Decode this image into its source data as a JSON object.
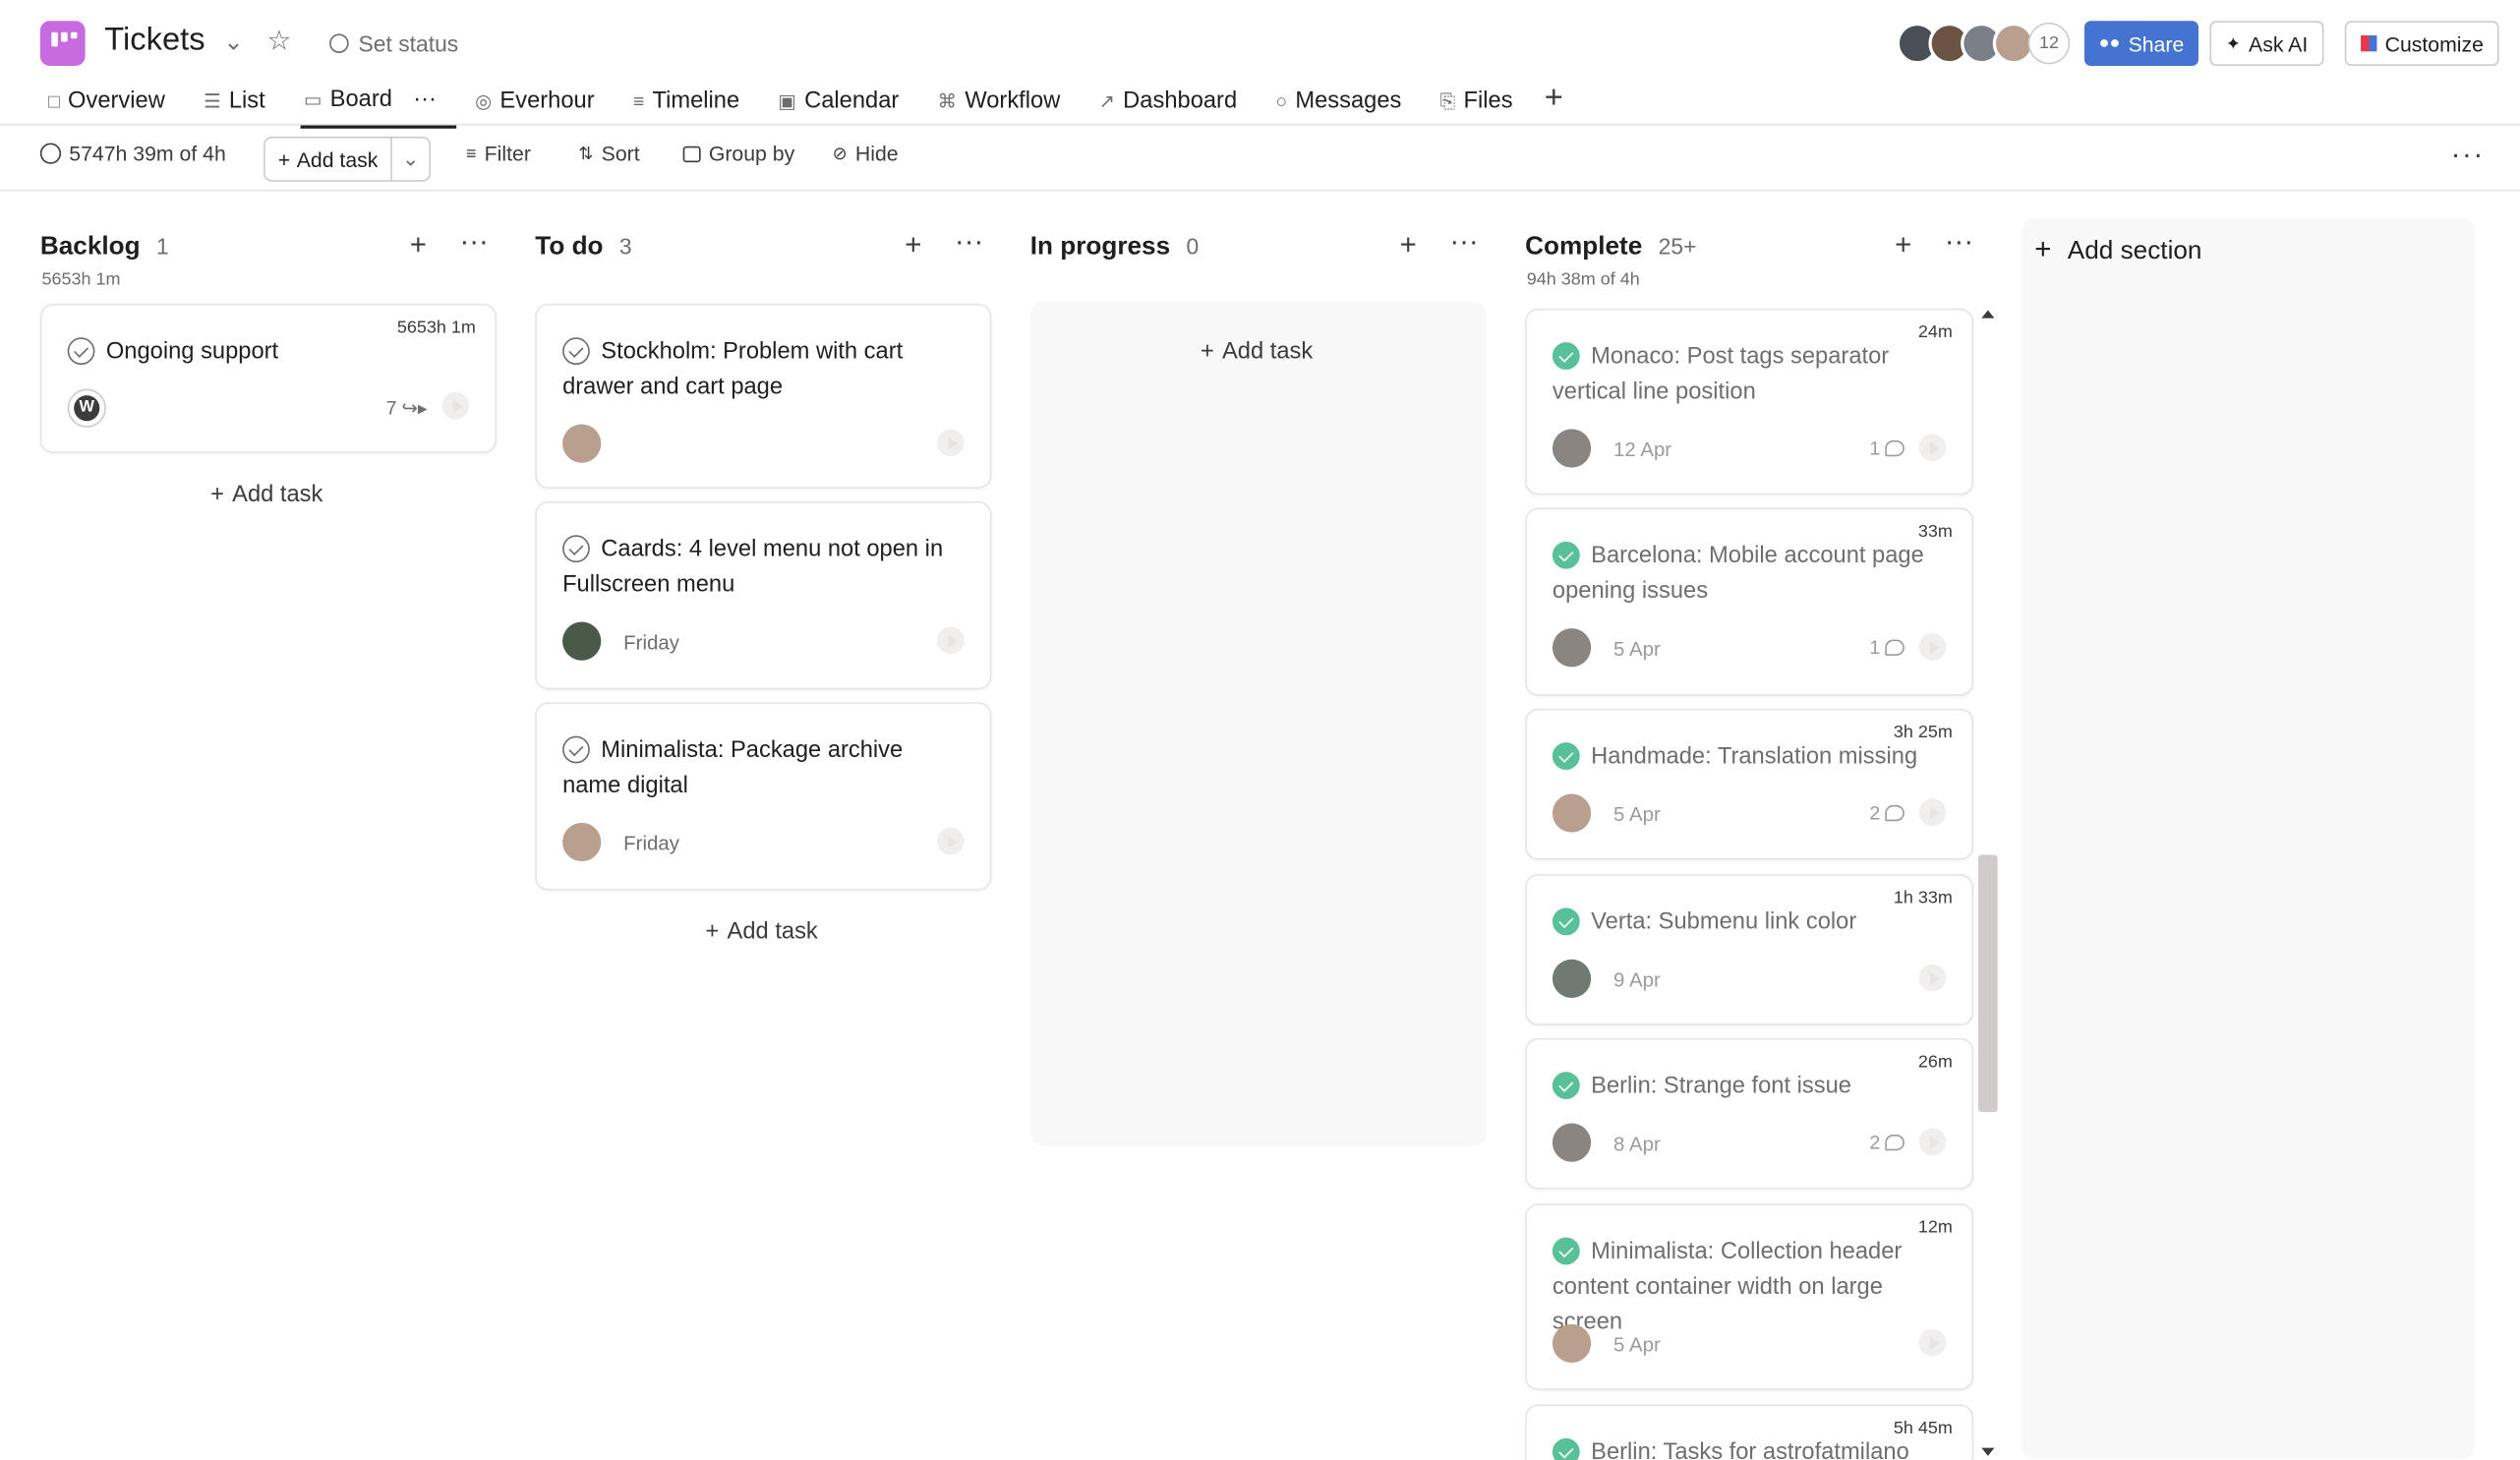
{
  "header": {
    "title": "Tickets",
    "set_status": "Set status",
    "member_count": "12",
    "share": "Share",
    "ask_ai": "Ask AI",
    "customize": "Customize",
    "brand_color": "#c86be0",
    "share_color": "#4573d2"
  },
  "tabs": [
    {
      "label": "Overview",
      "icon": "overview-icon"
    },
    {
      "label": "List",
      "icon": "list-icon"
    },
    {
      "label": "Board",
      "icon": "board-icon",
      "active": true
    },
    {
      "label": "Everhour",
      "icon": "everhour-icon"
    },
    {
      "label": "Timeline",
      "icon": "timeline-icon"
    },
    {
      "label": "Calendar",
      "icon": "calendar-icon"
    },
    {
      "label": "Workflow",
      "icon": "workflow-icon"
    },
    {
      "label": "Dashboard",
      "icon": "dashboard-icon"
    },
    {
      "label": "Messages",
      "icon": "messages-icon"
    },
    {
      "label": "Files",
      "icon": "files-icon"
    }
  ],
  "toolbar": {
    "time_total": "5747h 39m of 4h",
    "add_task": "Add task",
    "filter": "Filter",
    "sort": "Sort",
    "group_by": "Group by",
    "hide": "Hide"
  },
  "columns": {
    "backlog": {
      "name": "Backlog",
      "count": "1",
      "sub": "5653h 1m",
      "add_task": "Add task",
      "cards": [
        {
          "title": "Ongoing support",
          "time": "5653h 1m",
          "subtasks": "7"
        }
      ]
    },
    "todo": {
      "name": "To do",
      "count": "3",
      "add_task": "Add task",
      "cards": [
        {
          "title": "Stockholm: Problem with cart drawer and cart page",
          "due": ""
        },
        {
          "title": "Caards: 4 level menu not open in Fullscreen menu",
          "due": "Friday"
        },
        {
          "title": "Minimalista: Package archive name digital",
          "due": "Friday"
        }
      ]
    },
    "inprogress": {
      "name": "In progress",
      "count": "0",
      "add_task": "Add task"
    },
    "complete": {
      "name": "Complete",
      "count": "25+",
      "sub": "94h 38m of 4h",
      "cards": [
        {
          "title": "Monaco: Post tags separator vertical line position",
          "time": "24m",
          "due": "12 Apr",
          "comments": "1"
        },
        {
          "title": "Barcelona: Mobile account page opening issues",
          "time": "33m",
          "due": "5 Apr",
          "comments": "1"
        },
        {
          "title": "Handmade: Translation missing",
          "time": "3h 25m",
          "due": "5 Apr",
          "comments": "2"
        },
        {
          "title": "Verta: Submenu link color",
          "time": "1h 33m",
          "due": "9 Apr",
          "comments": ""
        },
        {
          "title": "Berlin: Strange font issue",
          "time": "26m",
          "due": "8 Apr",
          "comments": "2"
        },
        {
          "title": "Minimalista: Collection header content container width on large screen",
          "time": "12m",
          "due": "5 Apr",
          "comments": ""
        },
        {
          "title": "Berlin: Tasks for astrofatmilano",
          "time": "5h 45m",
          "due": "",
          "comments": ""
        }
      ]
    }
  },
  "add_section": "Add section"
}
